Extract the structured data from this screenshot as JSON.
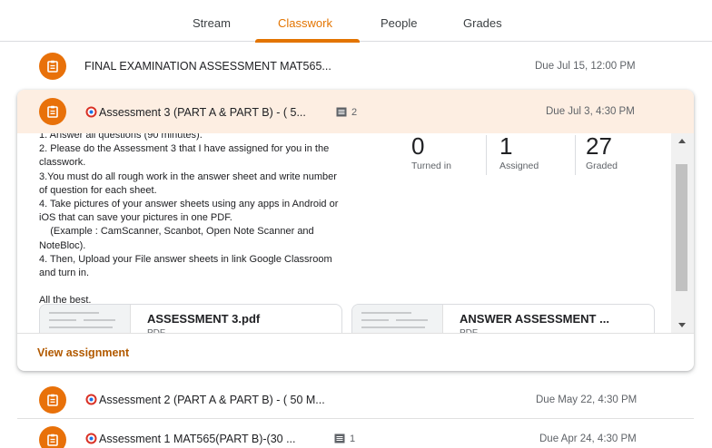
{
  "tabs": [
    {
      "label": "Stream",
      "active": false
    },
    {
      "label": "Classwork",
      "active": true
    },
    {
      "label": "People",
      "active": false
    },
    {
      "label": "Grades",
      "active": false
    }
  ],
  "colors": {
    "accent": "#e37400",
    "icon_bg": "#e8710a",
    "header_bg": "#fdeee2"
  },
  "items": {
    "final": {
      "title": "FINAL EXAMINATION ASSESSMENT MAT565...",
      "due": "Due Jul 15, 12:00 PM",
      "icon": "assignment-icon"
    },
    "a3": {
      "title": "Assessment 3 (PART A & PART B) - ( 5...",
      "comments": "2",
      "due": "Due Jul 3, 4:30 PM",
      "description": [
        "1. Answer all questions (90 minutes).",
        "2. Please do the Assessment 3 that I have assigned for you in the",
        "classwork.",
        "3.You must do all rough work in the answer sheet and write number",
        "of question for each sheet.",
        "4. Take pictures of your answer sheets using any apps in Android or",
        "iOS that can save your pictures in one PDF.",
        "    (Example : CamScanner, Scanbot, Open Note Scanner and",
        "NoteBloc).",
        "4. Then, Upload your File answer sheets in link Google Classroom",
        "and turn in.",
        "",
        "All the best."
      ],
      "stats": [
        {
          "value": "0",
          "label": "Turned in"
        },
        {
          "value": "1",
          "label": "Assigned"
        },
        {
          "value": "27",
          "label": "Graded"
        }
      ],
      "attachments": [
        {
          "title": "ASSESSMENT 3.pdf",
          "type": "PDF"
        },
        {
          "title": "ANSWER ASSESSMENT ...",
          "type": "PDF"
        }
      ],
      "view_link": "View assignment"
    },
    "a2": {
      "title": "Assessment 2 (PART A & PART B) - ( 50 M...",
      "due": "Due May 22, 4:30 PM"
    },
    "a1": {
      "title": "Assessment 1 MAT565(PART B)-(30 ...",
      "comments": "1",
      "due": "Due Apr 24, 4:30 PM"
    }
  }
}
